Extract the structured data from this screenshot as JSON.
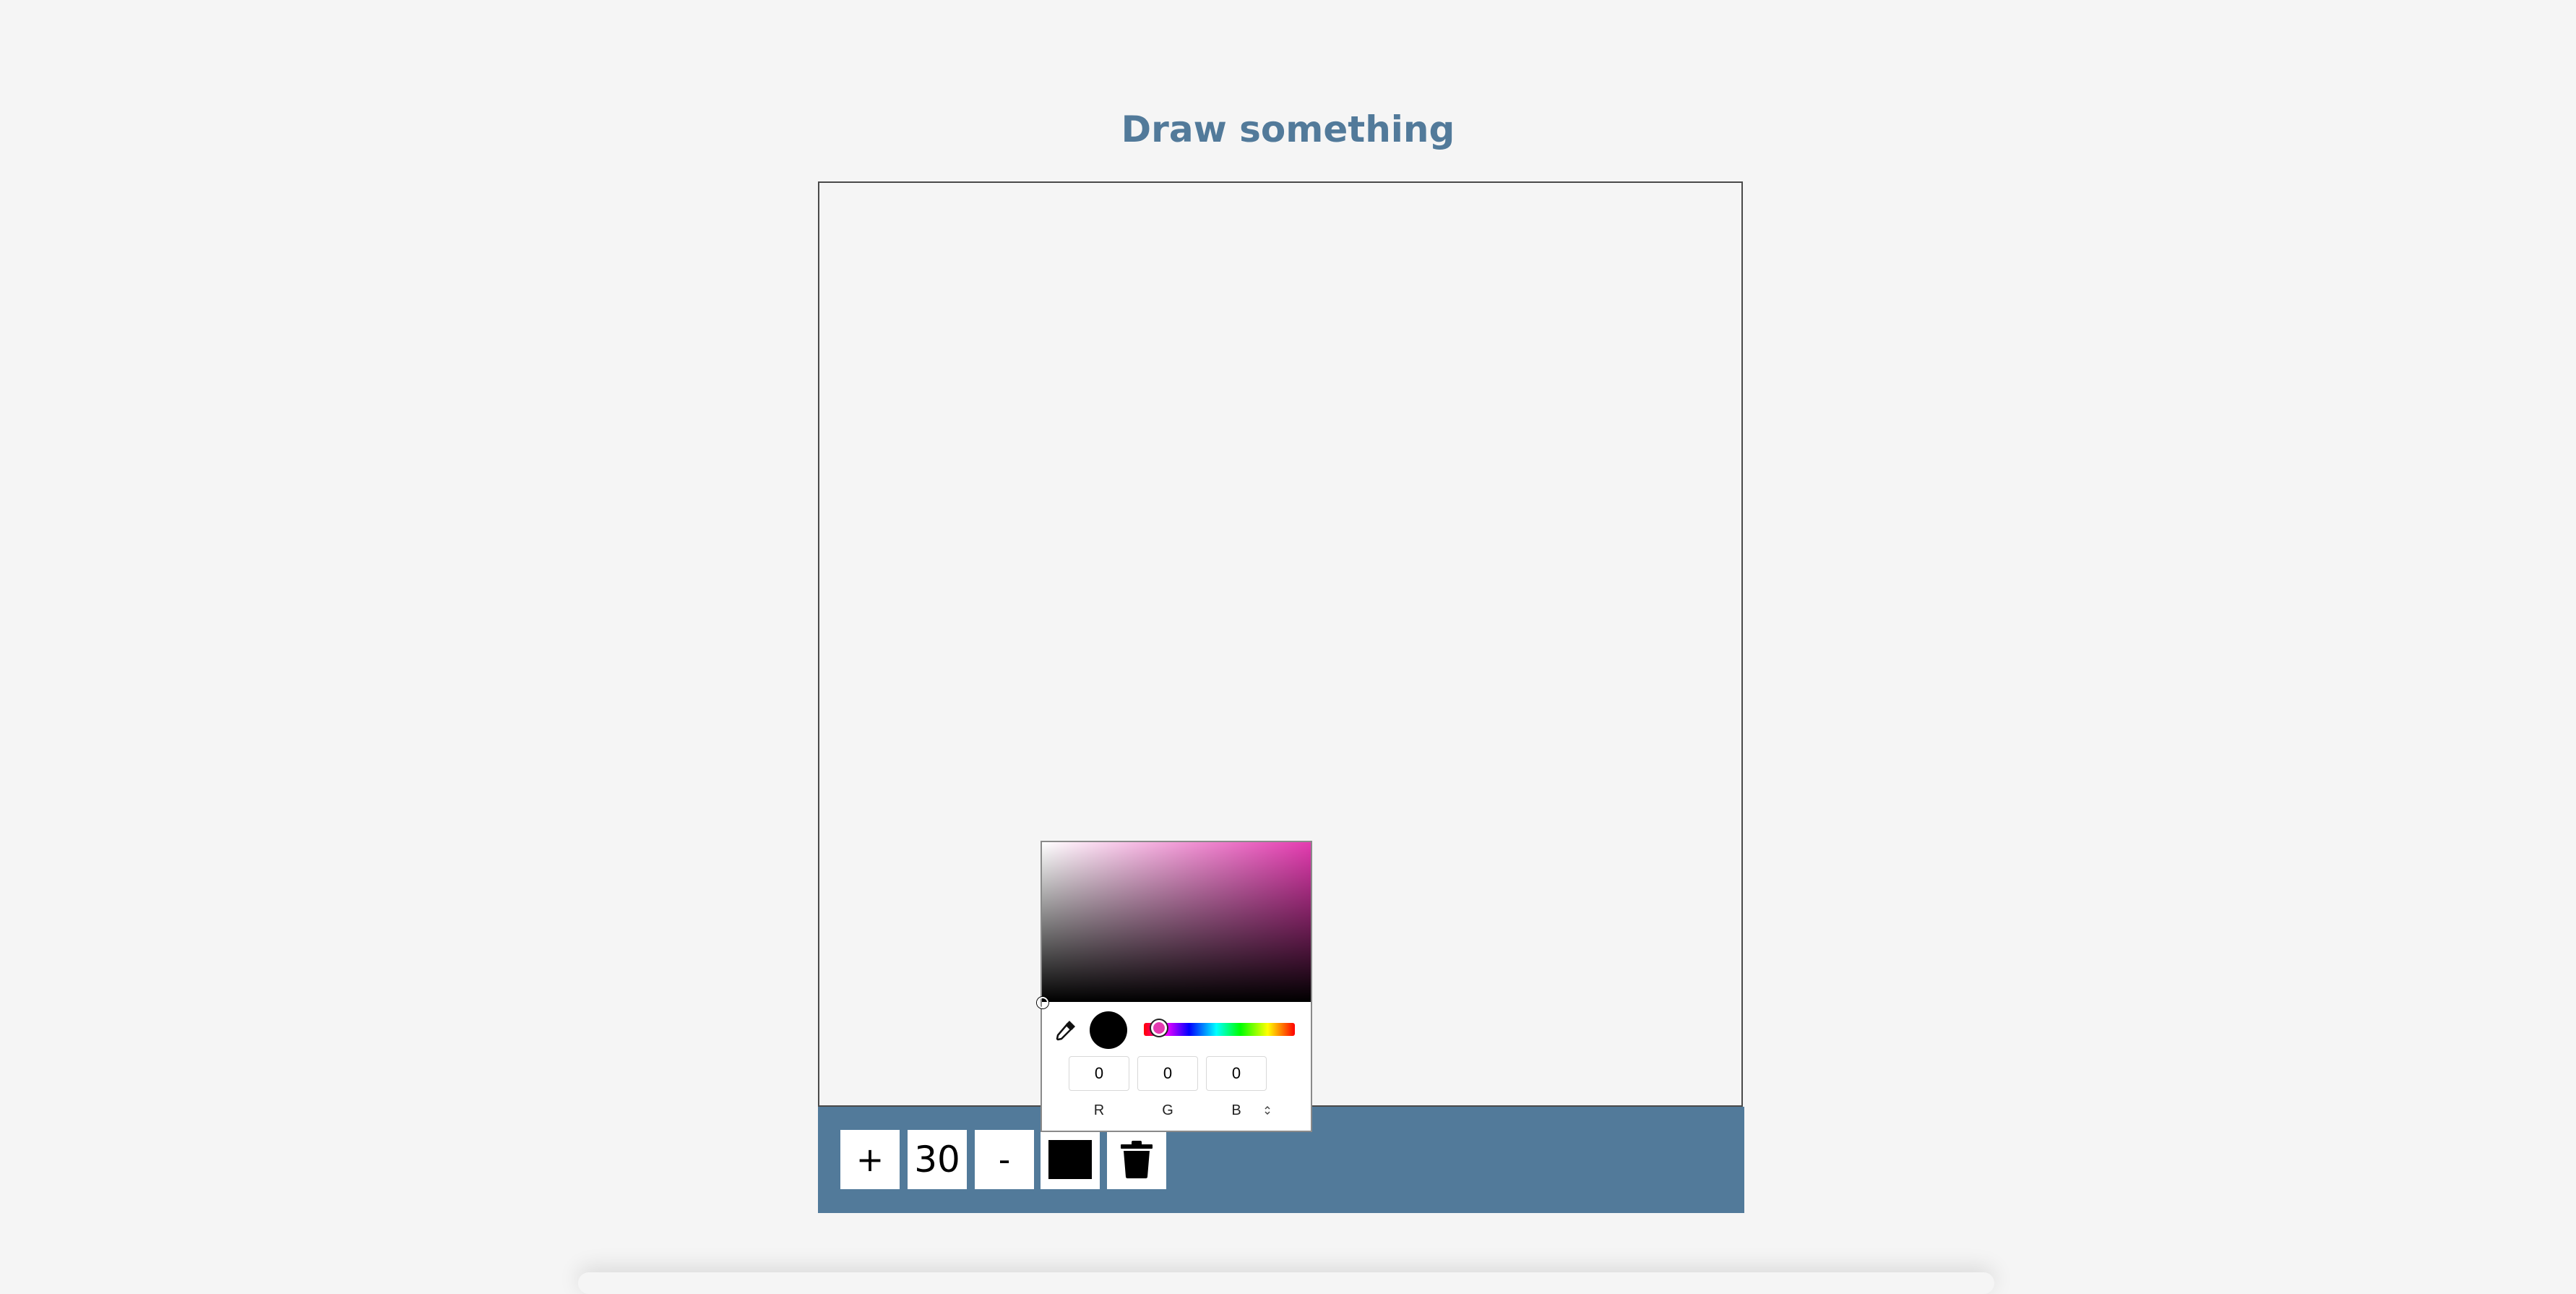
{
  "page": {
    "title": "Draw something"
  },
  "toolbox": {
    "increase_label": "+",
    "size_value": "30",
    "decrease_label": "-",
    "current_color": "#000000",
    "clear_icon": "trash-icon"
  },
  "color_picker": {
    "hue_color": "#e43bb0",
    "preview_color": "#000000",
    "eyedropper_icon": "eyedropper-icon",
    "toggle_icon": "chevron-up-down-icon",
    "channels": [
      {
        "label": "R",
        "value": "0"
      },
      {
        "label": "G",
        "value": "0"
      },
      {
        "label": "B",
        "value": "0"
      }
    ]
  },
  "colors": {
    "background": "#f5f5f5",
    "accent": "#527a9a",
    "canvas_border": "#4a4a4a"
  }
}
